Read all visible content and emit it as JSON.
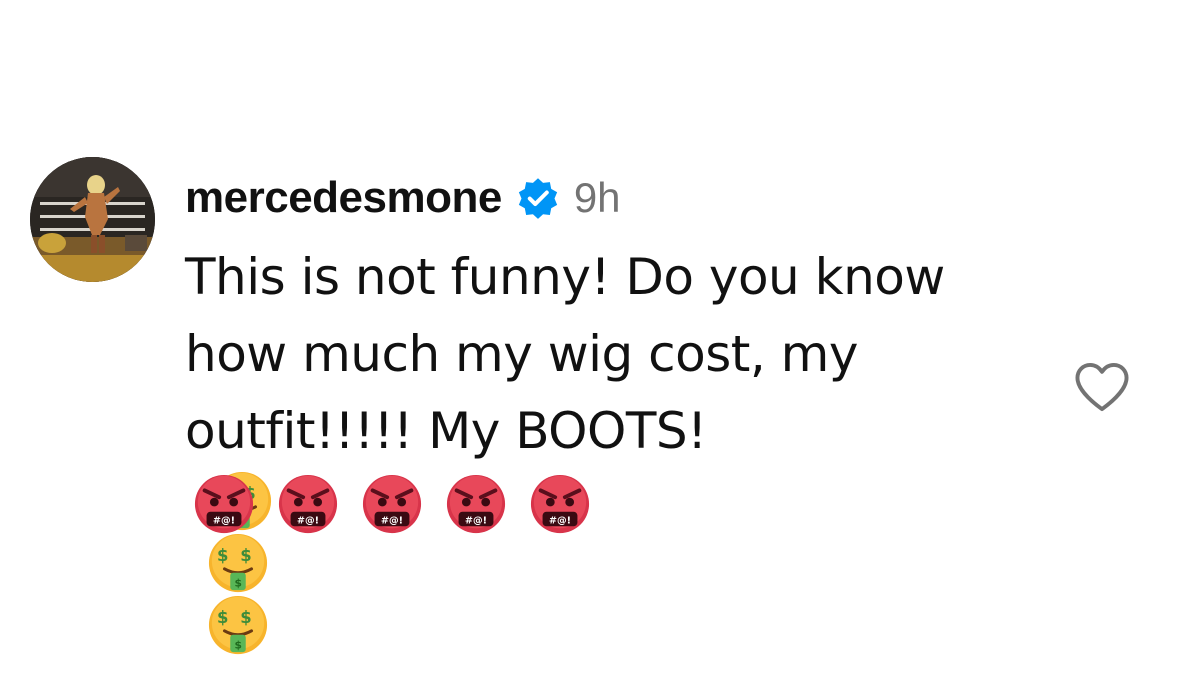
{
  "comment": {
    "username": "mercedesmone",
    "verified": true,
    "timestamp": "9h",
    "lines": [
      "This is not funny! Do you know",
      "how much my wig cost, my",
      "outfit!!!!! My BOOTS!"
    ],
    "inline_emojis": [
      "money-mouth-face",
      "money-mouth-face",
      "money-mouth-face"
    ],
    "emoji_row": [
      "face-with-symbols-on-mouth",
      "face-with-symbols-on-mouth",
      "face-with-symbols-on-mouth",
      "face-with-symbols-on-mouth",
      "face-with-symbols-on-mouth"
    ]
  },
  "icons": {
    "verified": "verified-badge-icon",
    "like": "heart-outline-icon"
  },
  "colors": {
    "verified_blue": "#0095f6",
    "timestamp_gray": "#737373",
    "text": "#111111",
    "heart_stroke": "#737373"
  }
}
